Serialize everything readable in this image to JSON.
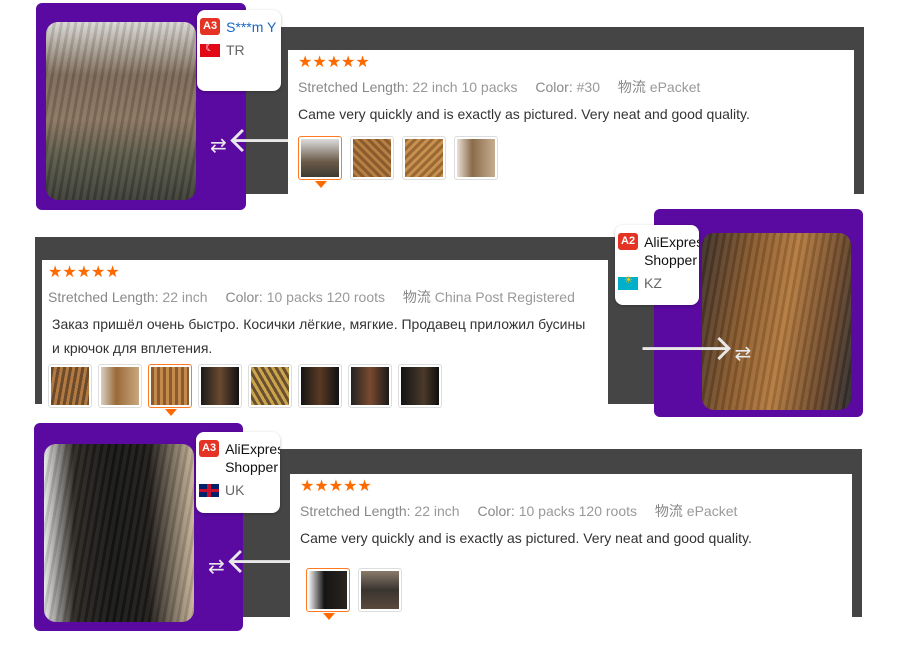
{
  "reviews": [
    {
      "badge": "A3",
      "user": "S***m Y",
      "country": "TR",
      "stars": "★★★★★",
      "length_label": "Stretched Length:",
      "length": "22 inch 10 packs",
      "color_label": "Color:",
      "color": "#30",
      "ship_label": "物流",
      "ship": "ePacket",
      "text": "Came very quickly and is exactly as pictured. Very neat and good quality."
    },
    {
      "badge": "A2",
      "user": "AliExpress Shopper",
      "country": "KZ",
      "stars": "★★★★★",
      "length_label": "Stretched Length:",
      "length": "22 inch",
      "color_label": "Color:",
      "color": "10 packs 120 roots",
      "ship_label": "物流",
      "ship": "China Post Registered",
      "text": "Заказ пришёл очень быстро. Косички лёгкие, мягкие. Продавец приложил бусины и крючок для вплетения."
    },
    {
      "badge": "A3",
      "user": "AliExpress Shopper",
      "country": "UK",
      "stars": "★★★★★",
      "length_label": "Stretched Length:",
      "length": "22 inch",
      "color_label": "Color:",
      "color": "10 packs 120 roots",
      "ship_label": "物流",
      "ship": "ePacket",
      "text": "Came very quickly and is exactly as pictured. Very neat and good quality."
    }
  ],
  "colors": {
    "purple": "#5a0aa0",
    "dark": "#454545",
    "star": "#ff6a00",
    "badge": "#e43225",
    "link": "#1a66c7"
  }
}
